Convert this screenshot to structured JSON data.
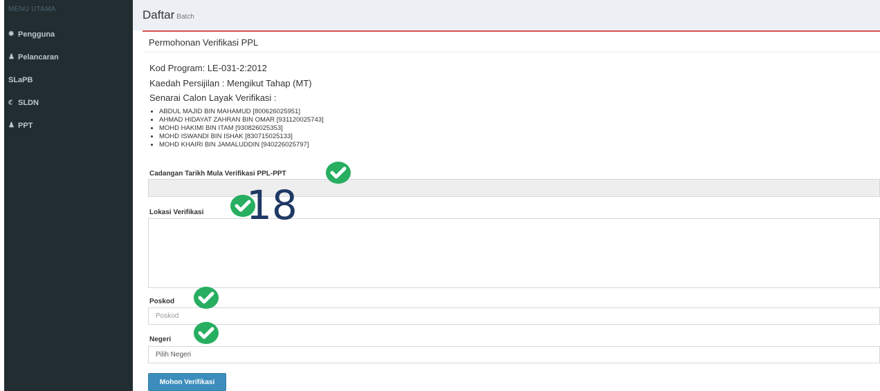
{
  "sidebar": {
    "header": "MENU UTAMA",
    "items": [
      {
        "label": "Pengguna",
        "icon": "users-icon"
      },
      {
        "label": "Pelancaran",
        "icon": "user-icon"
      },
      {
        "label": "SLaPB",
        "icon": ""
      },
      {
        "label": "SLDN",
        "icon": "sldn-logo-icon"
      },
      {
        "label": "PPT",
        "icon": "user-icon"
      }
    ]
  },
  "header": {
    "title": "Daftar",
    "subtitle": "Batch"
  },
  "box": {
    "title": "Permohonan Verifikasi PPL",
    "kod_program": "Kod Program: LE-031-2:2012",
    "kaedah": "Kaedah Persijilan : Mengikut Tahap (MT)",
    "senarai_heading": "Senarai Calon Layak Verifikasi :",
    "candidates": [
      "ABDUL MAJID BIN MAHAMUD [800626025951]",
      "AHMAD HIDAYAT ZAHRAN BIN OMAR [931120025743]",
      "MOHD HAKIMI BIN ITAM [930826025353]",
      "MOHD ISWANDI BIN ISHAK [830715025133]",
      "MOHD KHAIRI BIN JAMALUDDIN [940226025797]"
    ]
  },
  "form": {
    "tarikh_label": "Cadangan Tarikh Mula Verifikasi PPL-PPT",
    "tarikh_value": "",
    "lokasi_label": "Lokasi Verifikasi",
    "lokasi_value": "",
    "poskod_label": "Poskod",
    "poskod_placeholder": "Poskod",
    "negeri_label": "Negeri",
    "negeri_selected": "Pilih Negeri",
    "submit_label": "Mohon Verifikasi"
  },
  "annotation": {
    "number": "18",
    "check_color": "#27ae60"
  }
}
